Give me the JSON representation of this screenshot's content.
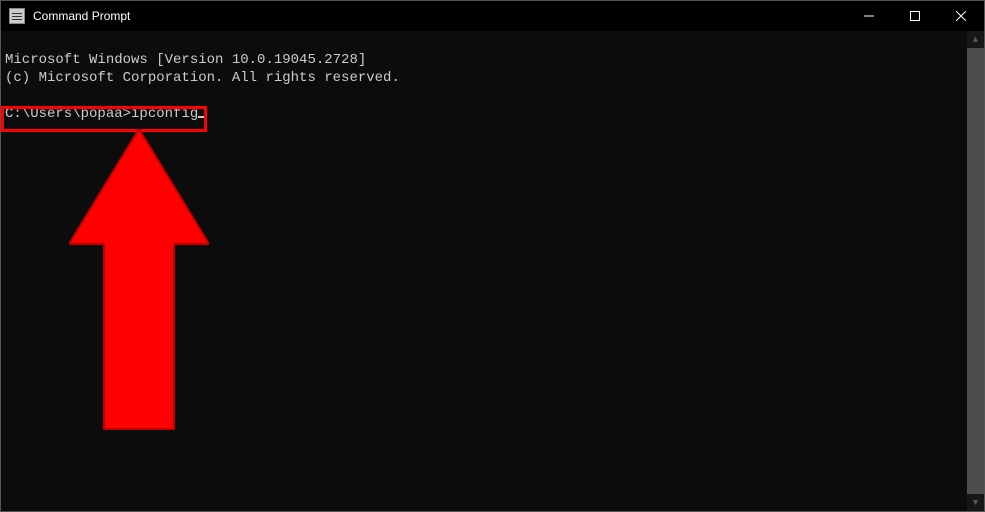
{
  "window": {
    "title": "Command Prompt"
  },
  "terminal": {
    "line1": "Microsoft Windows [Version 10.0.19045.2728]",
    "line2": "(c) Microsoft Corporation. All rights reserved.",
    "blank": "",
    "prompt": "C:\\Users\\popaa>",
    "command": "ipconfig"
  },
  "annotation": {
    "color": "#ff0000"
  }
}
